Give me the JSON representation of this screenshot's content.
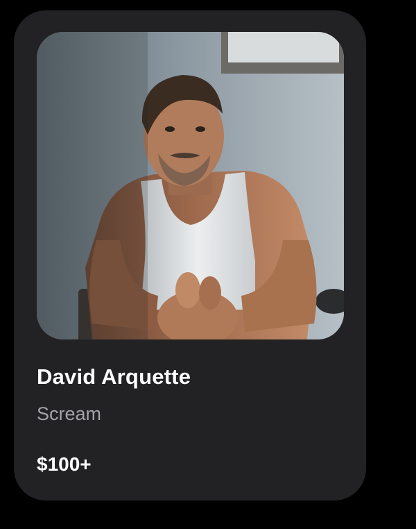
{
  "card": {
    "name": "David Arquette",
    "subtitle": "Scream",
    "price": "$100+"
  },
  "colors": {
    "page_background": "#000000",
    "card_background": "#222225",
    "name_text": "#ffffff",
    "subtitle_text": "#a3a3a8",
    "price_text": "#ffffff"
  },
  "photo": {
    "alt": "portrait-photo"
  }
}
